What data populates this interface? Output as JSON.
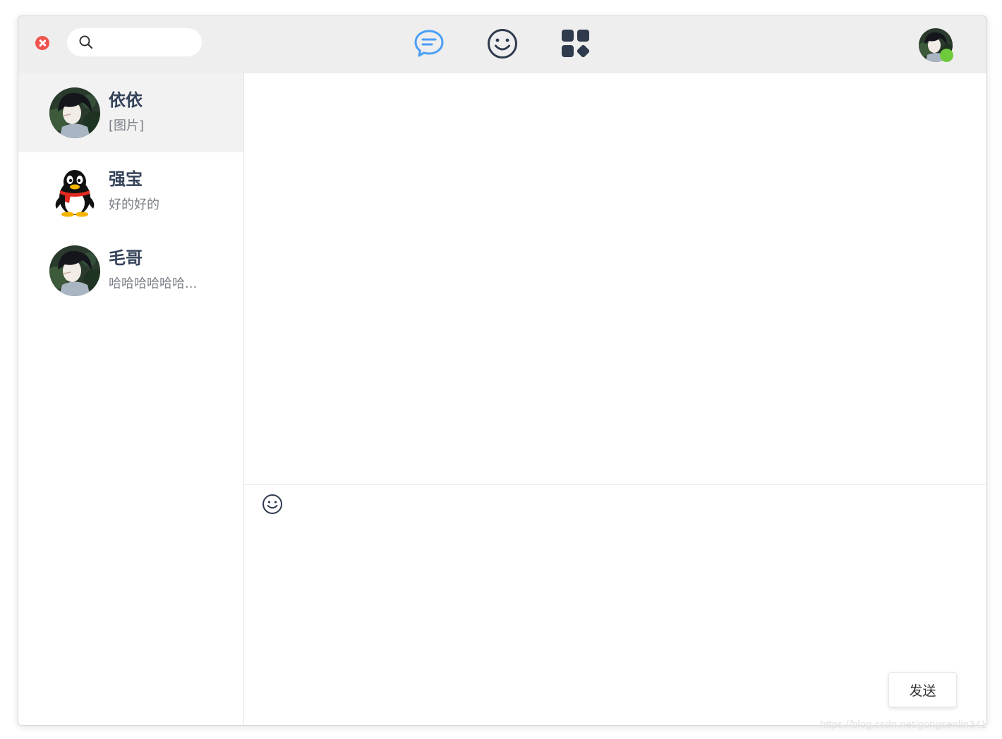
{
  "search": {
    "value": "",
    "placeholder": ""
  },
  "nav": {
    "chat_icon": "chat-bubble-icon",
    "emoji_icon": "smiley-icon",
    "apps_icon": "apps-grid-icon",
    "active": "chat"
  },
  "user": {
    "status": "online"
  },
  "contacts": [
    {
      "name": "依依",
      "preview": "[图片]",
      "avatar": "anime-boy-avatar",
      "active": true
    },
    {
      "name": "强宝",
      "preview": "好的好的",
      "avatar": "qq-penguin-avatar",
      "active": false
    },
    {
      "name": "毛哥",
      "preview": "哈哈哈哈哈哈...",
      "avatar": "anime-boy-avatar",
      "active": false
    }
  ],
  "composer": {
    "value": "",
    "send_label": "发送"
  },
  "watermark": "https://blog.csdn.net/gongsenlin341",
  "colors": {
    "accent": "#4a9ff5",
    "close": "#f0544d",
    "online": "#6ecb3c",
    "topbar": "#eeeeee",
    "active_row": "#f2f2f2",
    "contact_name": "#35435a",
    "icon_dark": "#2f3b4d"
  }
}
